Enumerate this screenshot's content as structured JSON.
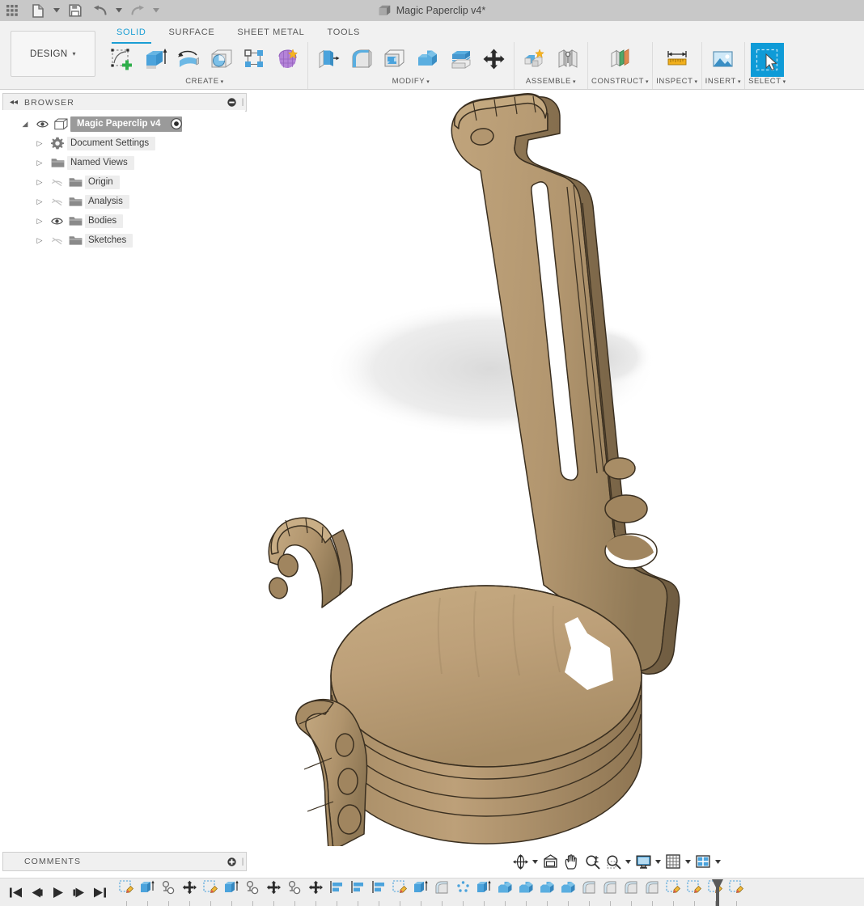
{
  "app": {
    "document_title": "Magic Paperclip v4*",
    "quick_access": [
      {
        "name": "app-grid-icon",
        "label": "Show Data Panel",
        "caret": false
      },
      {
        "name": "file-icon",
        "label": "File",
        "caret": true
      },
      {
        "name": "save-icon",
        "label": "Save",
        "caret": false
      },
      {
        "name": "undo-icon",
        "label": "Undo",
        "caret": true
      },
      {
        "name": "redo-icon",
        "label": "Redo",
        "caret": true
      }
    ]
  },
  "workspace": {
    "label": "DESIGN",
    "caret": "▾"
  },
  "tabs": [
    {
      "label": "SOLID",
      "active": true
    },
    {
      "label": "SURFACE",
      "active": false
    },
    {
      "label": "SHEET METAL",
      "active": false
    },
    {
      "label": "TOOLS",
      "active": false
    }
  ],
  "panels": [
    {
      "label": "CREATE",
      "caret": "▾",
      "icons": [
        {
          "name": "create-sketch-icon",
          "label": "Create Sketch"
        },
        {
          "name": "extrude-icon",
          "label": "Extrude"
        },
        {
          "name": "revolve-icon",
          "label": "Revolve"
        },
        {
          "name": "sphere-icon",
          "label": "Sphere"
        },
        {
          "name": "pattern-icon",
          "label": "Rectangular Pattern"
        },
        {
          "name": "create-form-icon",
          "label": "Create Form"
        }
      ]
    },
    {
      "label": "MODIFY",
      "caret": "▾",
      "icons": [
        {
          "name": "press-pull-icon",
          "label": "Press Pull"
        },
        {
          "name": "fillet-icon",
          "label": "Fillet"
        },
        {
          "name": "shell-icon",
          "label": "Shell"
        },
        {
          "name": "combine-icon",
          "label": "Combine"
        },
        {
          "name": "split-face-icon",
          "label": "Split Face"
        },
        {
          "name": "move-copy-icon",
          "label": "Move/Copy"
        }
      ]
    },
    {
      "label": "ASSEMBLE",
      "caret": "▾",
      "icons": [
        {
          "name": "new-component-icon",
          "label": "New Component"
        },
        {
          "name": "joint-icon",
          "label": "Joint"
        }
      ]
    },
    {
      "label": "CONSTRUCT",
      "caret": "▾",
      "icons": [
        {
          "name": "offset-plane-icon",
          "label": "Offset Plane"
        }
      ]
    },
    {
      "label": "INSPECT",
      "caret": "▾",
      "icons": [
        {
          "name": "measure-icon",
          "label": "Measure"
        }
      ]
    },
    {
      "label": "INSERT",
      "caret": "▾",
      "icons": [
        {
          "name": "insert-image-icon",
          "label": "Insert Image"
        }
      ]
    },
    {
      "label": "SELECT",
      "caret": "▾",
      "icons": [
        {
          "name": "select-icon",
          "label": "Select",
          "selected": true
        }
      ]
    }
  ],
  "browser": {
    "header": "BROWSER",
    "collapse_icon": "◂◂",
    "root": {
      "label": "Magic Paperclip v4",
      "visible": true,
      "arrow": "◢"
    },
    "items": [
      {
        "label": "Document Settings",
        "icon": "gear-icon",
        "eye": "none",
        "arrow": "▷"
      },
      {
        "label": "Named Views",
        "icon": "folder-icon",
        "eye": "none",
        "arrow": "▷"
      },
      {
        "label": "Origin",
        "icon": "folder-icon",
        "eye": "hidden",
        "arrow": "▷"
      },
      {
        "label": "Analysis",
        "icon": "folder-icon",
        "eye": "hidden",
        "arrow": "▷"
      },
      {
        "label": "Bodies",
        "icon": "folder-icon",
        "eye": "visible",
        "arrow": "▷"
      },
      {
        "label": "Sketches",
        "icon": "folder-icon",
        "eye": "hidden",
        "arrow": "▷"
      }
    ]
  },
  "comments": {
    "header": "COMMENTS",
    "add_icon": "⊕"
  },
  "navbar": [
    {
      "name": "orbit-icon",
      "label": "Orbit",
      "caret": true
    },
    {
      "name": "look-at-icon",
      "label": "Look At",
      "caret": false
    },
    {
      "name": "pan-icon",
      "label": "Pan",
      "caret": false
    },
    {
      "name": "zoom-icon",
      "label": "Zoom",
      "caret": false
    },
    {
      "name": "fit-icon",
      "label": "Fit",
      "caret": true
    },
    {
      "name": "display-settings-icon",
      "label": "Display Settings",
      "caret": true
    },
    {
      "name": "grid-snap-icon",
      "label": "Grid and Snaps",
      "caret": true
    },
    {
      "name": "viewports-icon",
      "label": "Viewports",
      "caret": true
    }
  ],
  "timeline": {
    "playback": [
      {
        "name": "go-to-beginning-icon",
        "label": "Go to Beginning"
      },
      {
        "name": "step-back-icon",
        "label": "Step Back"
      },
      {
        "name": "play-icon",
        "label": "Play"
      },
      {
        "name": "step-forward-icon",
        "label": "Step Forward"
      },
      {
        "name": "go-to-end-icon",
        "label": "Go to End"
      }
    ],
    "features": [
      {
        "name": "timeline-sketch",
        "type": "sketch",
        "label": "Sketch"
      },
      {
        "name": "timeline-extrude",
        "type": "extrude",
        "label": "Extrude"
      },
      {
        "name": "timeline-joint",
        "type": "joint",
        "label": "Joint"
      },
      {
        "name": "timeline-move",
        "type": "move",
        "label": "Move/Copy"
      },
      {
        "name": "timeline-sketch",
        "type": "sketch",
        "label": "Sketch"
      },
      {
        "name": "timeline-extrude",
        "type": "extrude",
        "label": "Extrude"
      },
      {
        "name": "timeline-joint",
        "type": "joint",
        "label": "Joint"
      },
      {
        "name": "timeline-move",
        "type": "move",
        "label": "Move/Copy"
      },
      {
        "name": "timeline-joint",
        "type": "joint",
        "label": "Joint"
      },
      {
        "name": "timeline-move",
        "type": "move",
        "label": "Move/Copy"
      },
      {
        "name": "timeline-align",
        "type": "align",
        "label": "Align"
      },
      {
        "name": "timeline-align",
        "type": "align",
        "label": "Align"
      },
      {
        "name": "timeline-align",
        "type": "align",
        "label": "Align"
      },
      {
        "name": "timeline-sketch",
        "type": "sketch",
        "label": "Sketch"
      },
      {
        "name": "timeline-extrude",
        "type": "extrude",
        "label": "Extrude"
      },
      {
        "name": "timeline-fillet",
        "type": "fillet",
        "label": "Fillet"
      },
      {
        "name": "timeline-pattern",
        "type": "pattern",
        "label": "Pattern"
      },
      {
        "name": "timeline-extrude",
        "type": "extrude",
        "label": "Extrude"
      },
      {
        "name": "timeline-combine",
        "type": "combine",
        "label": "Combine"
      },
      {
        "name": "timeline-combine",
        "type": "combine",
        "label": "Combine"
      },
      {
        "name": "timeline-combine",
        "type": "combine",
        "label": "Combine"
      },
      {
        "name": "timeline-combine",
        "type": "combine",
        "label": "Combine"
      },
      {
        "name": "timeline-fillet",
        "type": "fillet",
        "label": "Fillet"
      },
      {
        "name": "timeline-fillet",
        "type": "fillet",
        "label": "Fillet"
      },
      {
        "name": "timeline-fillet",
        "type": "fillet",
        "label": "Fillet"
      },
      {
        "name": "timeline-fillet",
        "type": "fillet",
        "label": "Fillet"
      },
      {
        "name": "timeline-sketch",
        "type": "sketch",
        "label": "Sketch"
      },
      {
        "name": "timeline-sketch",
        "type": "sketch",
        "label": "Sketch"
      },
      {
        "name": "timeline-sketch",
        "type": "sketch",
        "label": "Sketch"
      },
      {
        "name": "timeline-sketch",
        "type": "sketch",
        "label": "Sketch"
      }
    ]
  },
  "model": {
    "name": "Magic Paperclip",
    "description": "Wooden magic paperclip assembly: stacked disc stack with two curved multi-hole clips and a tall slotted arm",
    "material_color": "#b79b6e",
    "material_light": "#cdb289",
    "material_dark": "#9c8258",
    "edge_color": "#3a2f20",
    "background_color": "#ffffff",
    "shadow_color": "#e2e2e2"
  },
  "colors": {
    "accent": "#1a9ed4",
    "titlebar": "#c8c8c8",
    "ribbon": "#f1f1f1",
    "panel_bg": "#f0f0f0",
    "tree_highlight": "#9a9a9a",
    "timeline_bg": "#eeeeee"
  }
}
